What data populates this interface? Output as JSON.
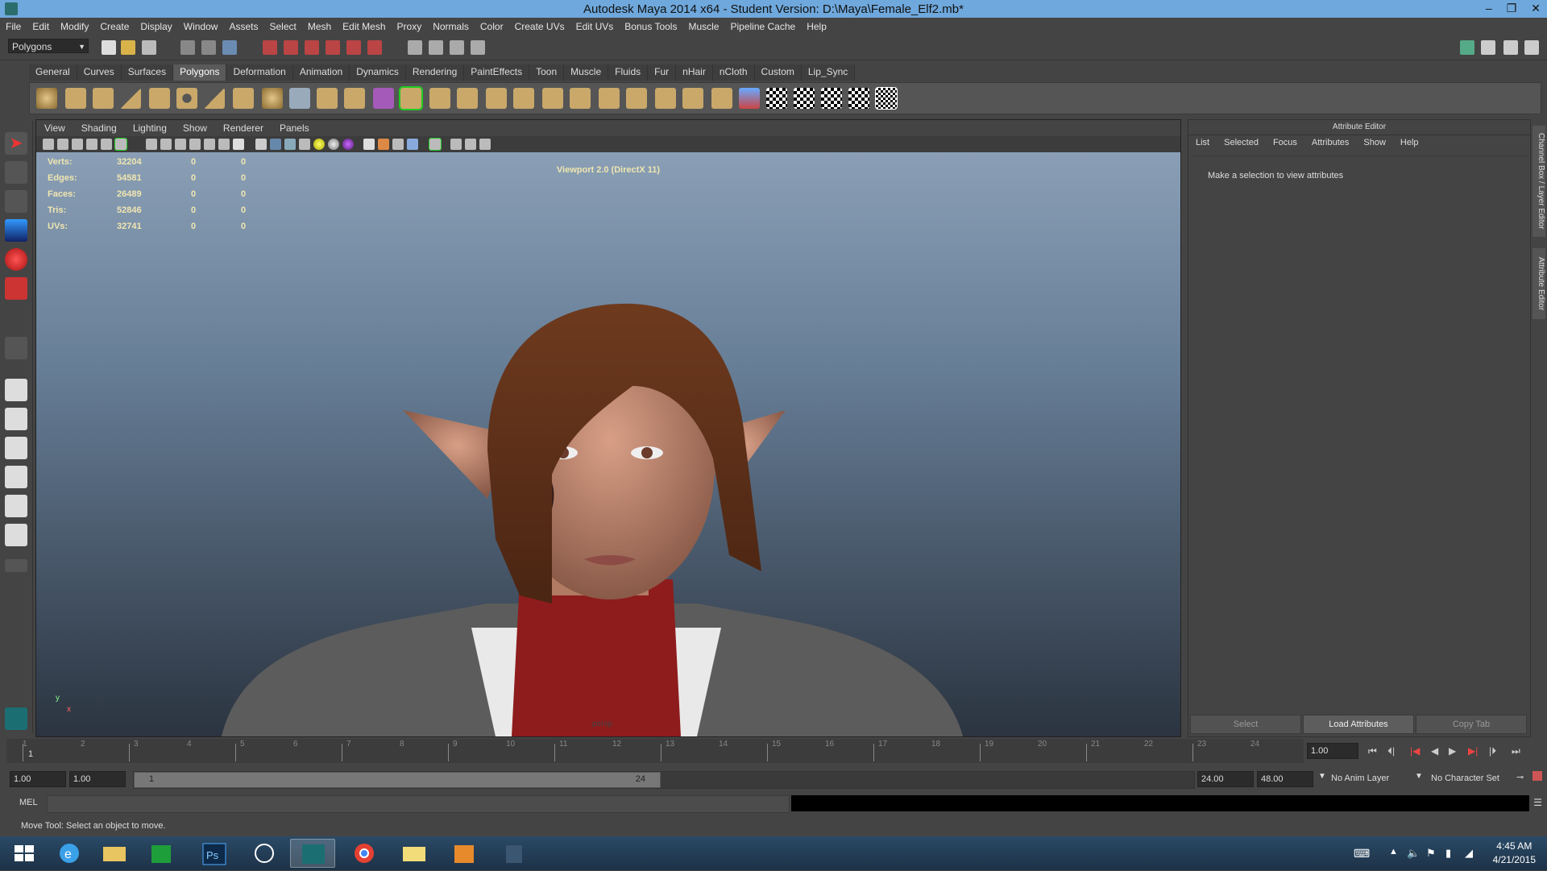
{
  "window": {
    "title": "Autodesk Maya 2014 x64 - Student Version: D:\\Maya\\Female_Elf2.mb*",
    "controls": [
      "–",
      "❐",
      "✕"
    ]
  },
  "menubar": [
    "File",
    "Edit",
    "Modify",
    "Create",
    "Display",
    "Window",
    "Assets",
    "Select",
    "Mesh",
    "Edit Mesh",
    "Proxy",
    "Normals",
    "Color",
    "Create UVs",
    "Edit UVs",
    "Bonus Tools",
    "Muscle",
    "Pipeline Cache",
    "Help"
  ],
  "statusline": {
    "menu_set": "Polygons"
  },
  "shelf": {
    "tabs": [
      "General",
      "Curves",
      "Surfaces",
      "Polygons",
      "Deformation",
      "Animation",
      "Dynamics",
      "Rendering",
      "PaintEffects",
      "Toon",
      "Muscle",
      "Fluids",
      "Fur",
      "nHair",
      "nCloth",
      "Custom",
      "Lip_Sync"
    ],
    "active_tab": "Polygons"
  },
  "viewport": {
    "menu": [
      "View",
      "Shading",
      "Lighting",
      "Show",
      "Renderer",
      "Panels"
    ],
    "renderer": "Viewport 2.0 (DirectX 11)",
    "camera": "persp",
    "axis": {
      "y": "y",
      "x": "x"
    },
    "hud": [
      {
        "label": "Verts:",
        "value": "32204",
        "sel": "0",
        "comp": "0"
      },
      {
        "label": "Edges:",
        "value": "54581",
        "sel": "0",
        "comp": "0"
      },
      {
        "label": "Faces:",
        "value": "26489",
        "sel": "0",
        "comp": "0"
      },
      {
        "label": "Tris:",
        "value": "52846",
        "sel": "0",
        "comp": "0"
      },
      {
        "label": "UVs:",
        "value": "32741",
        "sel": "0",
        "comp": "0"
      }
    ]
  },
  "attribute_editor": {
    "title": "Attribute Editor",
    "menu": [
      "List",
      "Selected",
      "Focus",
      "Attributes",
      "Show",
      "Help"
    ],
    "message": "Make a selection to view attributes",
    "buttons": {
      "select": "Select",
      "load": "Load Attributes",
      "copy": "Copy Tab"
    }
  },
  "side_tabs": {
    "channel_box": "Channel Box / Layer Editor",
    "attr_editor": "Attribute Editor"
  },
  "timeline": {
    "ticks": [
      "1",
      "2",
      "3",
      "4",
      "5",
      "6",
      "7",
      "8",
      "9",
      "10",
      "11",
      "12",
      "13",
      "14",
      "15",
      "16",
      "17",
      "18",
      "19",
      "20",
      "21",
      "22",
      "23",
      "24"
    ],
    "current_frame_marker": "1",
    "current_frame": "1.00"
  },
  "range": {
    "start": "1.00",
    "playback_start": "1.00",
    "handle_start": "1",
    "handle_end": "24",
    "playback_end": "24.00",
    "end": "48.00",
    "anim_layer": "No Anim Layer",
    "character_set": "No Character Set"
  },
  "command_line": {
    "label": "MEL"
  },
  "help_line": "Move Tool: Select an object to move.",
  "taskbar": {
    "time": "4:45 AM",
    "date": "4/21/2015",
    "apps": [
      "windows-start",
      "internet-explorer",
      "file-explorer",
      "store",
      "photoshop",
      "zbrush",
      "maya",
      "chrome",
      "folder",
      "media-player",
      "app"
    ]
  },
  "colors": {
    "title_bar": "#6fa8dc",
    "ui_bg": "#444444",
    "viewport_top": "#8fa4ba",
    "viewport_bottom": "#2b3440",
    "hud_text": "#f0e6b0"
  }
}
